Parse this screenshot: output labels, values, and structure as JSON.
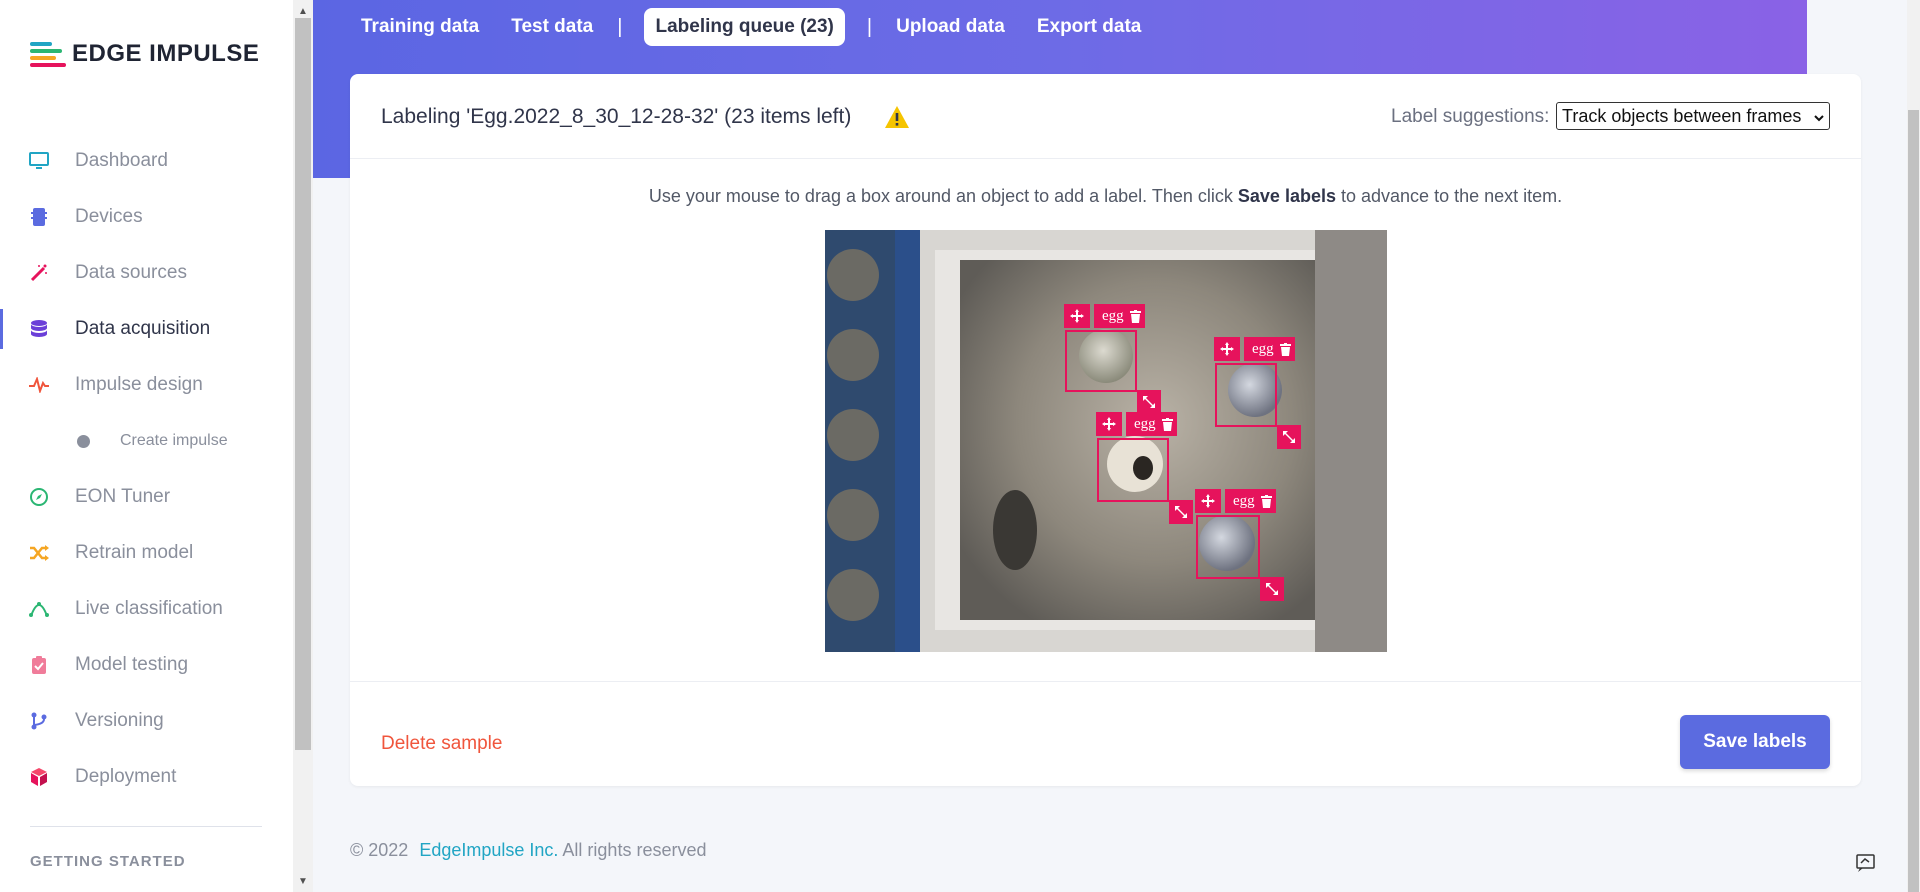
{
  "brand": {
    "name": "EDGE IMPULSE"
  },
  "sidebar": {
    "items": [
      {
        "label": "Dashboard",
        "icon": "monitor-icon",
        "color": "#21a5c4"
      },
      {
        "label": "Devices",
        "icon": "chip-icon",
        "color": "#5b6be0"
      },
      {
        "label": "Data sources",
        "icon": "wand-icon",
        "color": "#e6135c"
      },
      {
        "label": "Data acquisition",
        "icon": "database-icon",
        "color": "#6b3fd8",
        "active": true
      },
      {
        "label": "Impulse design",
        "icon": "pulse-icon",
        "color": "#f0553c"
      },
      {
        "label": "EON Tuner",
        "icon": "compass-icon",
        "color": "#2bb673"
      },
      {
        "label": "Retrain model",
        "icon": "shuffle-icon",
        "color": "#f5a623"
      },
      {
        "label": "Live classification",
        "icon": "bezier-icon",
        "color": "#2bb673"
      },
      {
        "label": "Model testing",
        "icon": "clipboard-icon",
        "color": "#f07c9a"
      },
      {
        "label": "Versioning",
        "icon": "branch-icon",
        "color": "#5b6be0"
      },
      {
        "label": "Deployment",
        "icon": "box-icon",
        "color": "#e6135c"
      }
    ],
    "sub_items": [
      {
        "label": "Create impulse"
      }
    ],
    "section_title": "GETTING STARTED"
  },
  "tabs": {
    "training": "Training data",
    "test": "Test data",
    "queue": "Labeling queue (23)",
    "upload": "Upload data",
    "export": "Export data",
    "separator": "|"
  },
  "card": {
    "title": "Labeling 'Egg.2022_8_30_12-28-32' (23 items left)",
    "suggestions_label": "Label suggestions:",
    "suggestions_value": "Track objects between frames",
    "instructions_pre": "Use your mouse to drag a box around an object to add a label. Then click",
    "instructions_bold": "Save labels",
    "instructions_post": "to advance to the next item.",
    "boxes": [
      {
        "label": "egg"
      },
      {
        "label": "egg"
      },
      {
        "label": "egg"
      },
      {
        "label": "egg"
      }
    ],
    "delete_label": "Delete sample",
    "save_label": "Save labels"
  },
  "footer": {
    "copyright": "© 2022",
    "company": "EdgeImpulse Inc.",
    "rights": "All rights reserved"
  },
  "colors": {
    "accent": "#5b6be0",
    "bbox": "#e6135c",
    "warning": "#f5c400"
  }
}
